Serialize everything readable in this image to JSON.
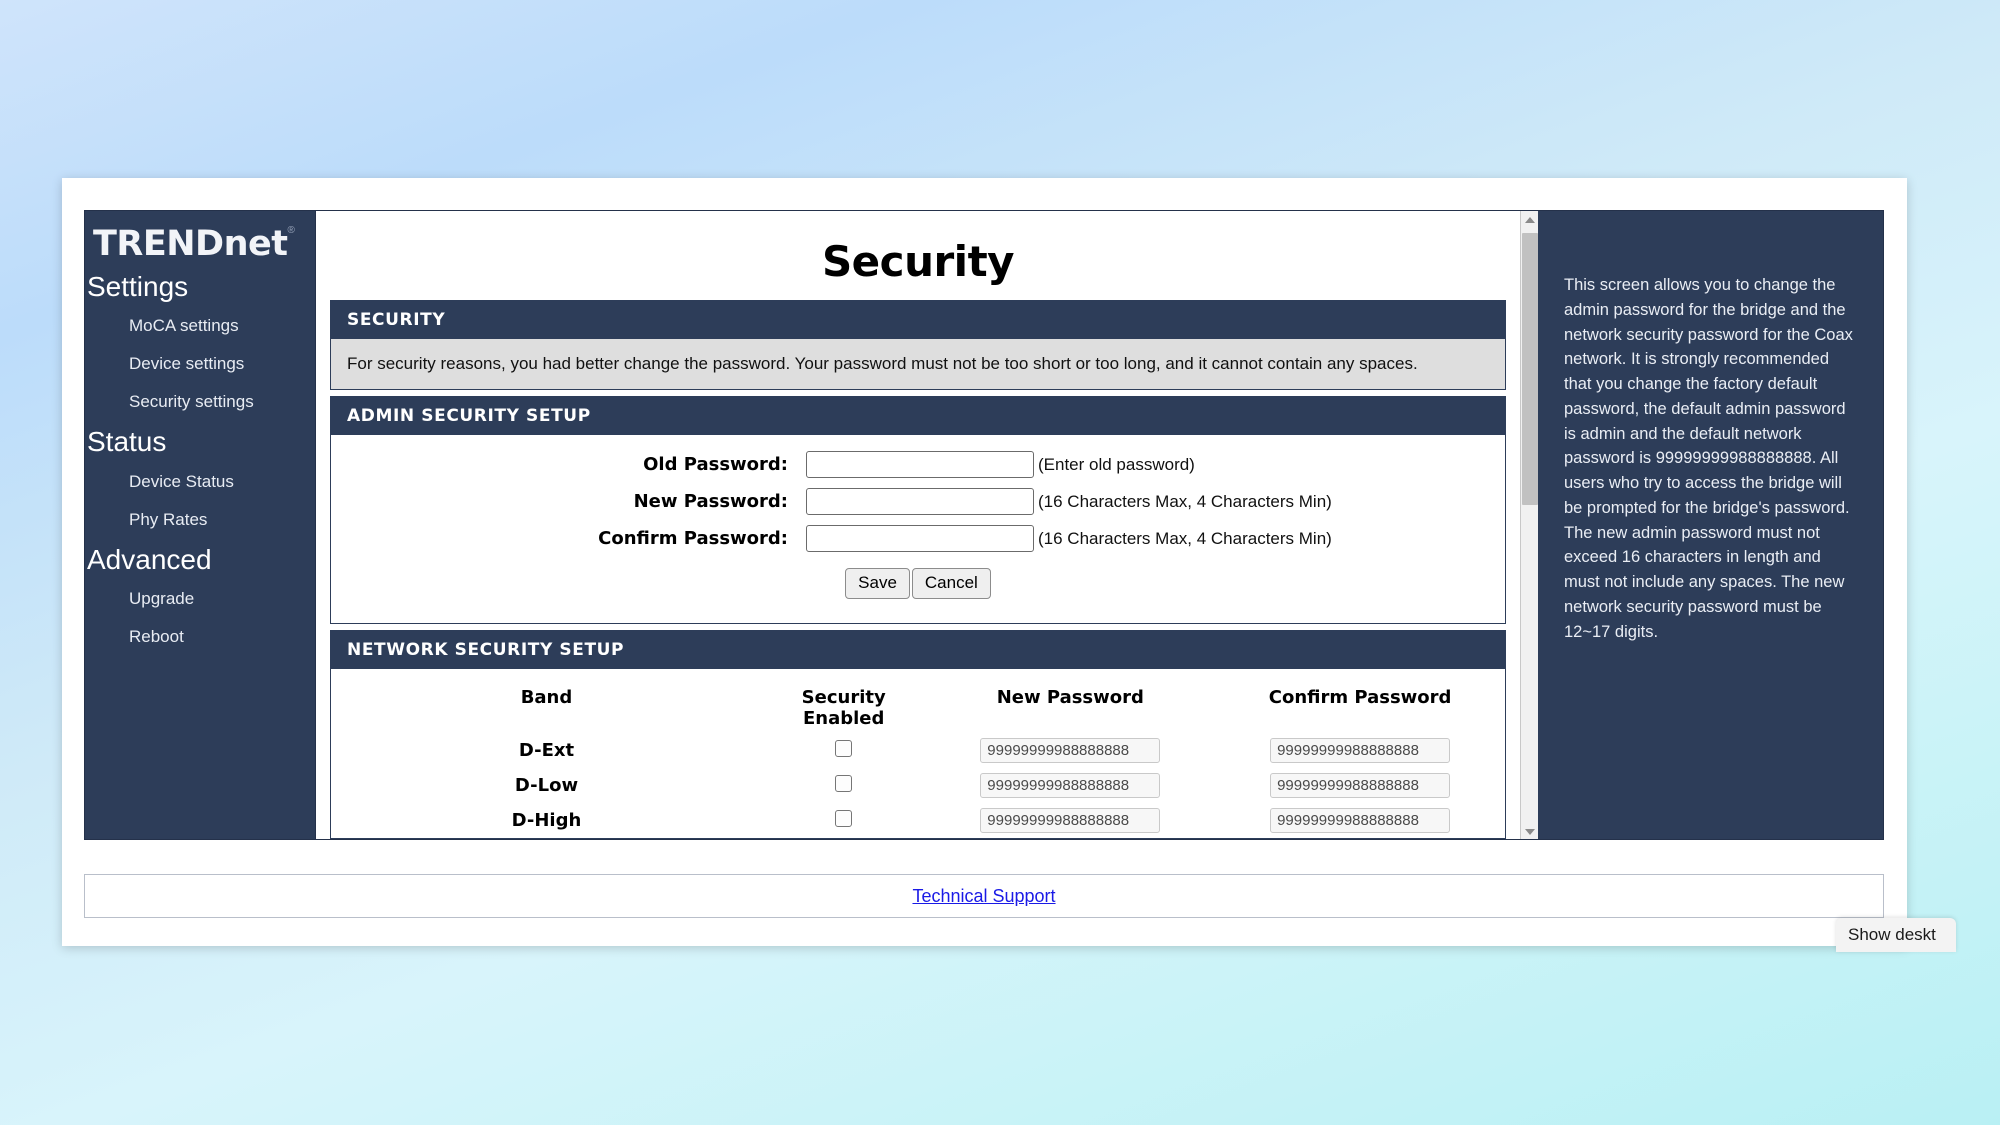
{
  "desktop": {
    "show_desktop_label": "Show deskt"
  },
  "sidebar": {
    "brand": "TRENDnet",
    "brand_mark": "®",
    "sections": [
      {
        "title": "Settings",
        "items": [
          "MoCA settings",
          "Device settings",
          "Security settings"
        ]
      },
      {
        "title": "Status",
        "items": [
          "Device Status",
          "Phy Rates"
        ]
      },
      {
        "title": "Advanced",
        "items": [
          "Upgrade",
          "Reboot"
        ]
      }
    ]
  },
  "main": {
    "page_title": "Security",
    "security_panel": {
      "header": "SECURITY",
      "note": "For security reasons, you had better change the password. Your password must not be too short or too long, and it cannot contain any spaces."
    },
    "admin_panel": {
      "header": "ADMIN SECURITY SETUP",
      "fields": [
        {
          "label": "Old Password:",
          "value": "",
          "hint": "(Enter old password)"
        },
        {
          "label": "New Password:",
          "value": "",
          "hint": "(16 Characters Max, 4 Characters Min)"
        },
        {
          "label": "Confirm Password:",
          "value": "",
          "hint": "(16 Characters Max, 4 Characters Min)"
        }
      ],
      "save_label": "Save",
      "cancel_label": "Cancel"
    },
    "network_panel": {
      "header": "NETWORK SECURITY SETUP",
      "columns": {
        "band": "Band",
        "security_enabled_line1": "Security",
        "security_enabled_line2": "Enabled",
        "new_password": "New Password",
        "confirm_password": "Confirm Password"
      },
      "rows": [
        {
          "band": "D-Ext",
          "enabled": false,
          "new_password": "99999999988888888",
          "confirm_password": "99999999988888888"
        },
        {
          "band": "D-Low",
          "enabled": false,
          "new_password": "99999999988888888",
          "confirm_password": "99999999988888888"
        },
        {
          "band": "D-High",
          "enabled": false,
          "new_password": "99999999988888888",
          "confirm_password": "99999999988888888"
        }
      ]
    }
  },
  "help": {
    "text": "This screen allows you to change the admin password for the bridge and the network security password for the Coax network. It is strongly recommended that you change the factory default password, the default admin password is admin and the default network password is 99999999988888888. All users who try to access the bridge will be prompted for the bridge's password. The new admin password must not exceed 16 characters in length and must not include any spaces. The new network security password must be 12~17 digits."
  },
  "footer": {
    "tech_support_label": "Technical Support"
  },
  "colors": {
    "navy": "#2d3d59",
    "note_gray": "#dedede",
    "link_blue": "#1a1ae6"
  }
}
